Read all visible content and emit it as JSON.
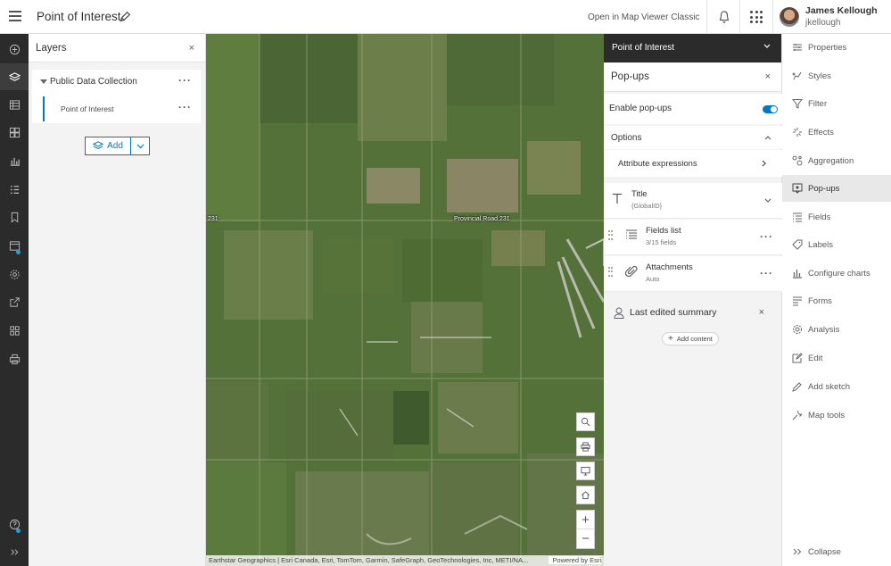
{
  "header": {
    "app_title": "Point of Interest",
    "open_classic": "Open in Map Viewer Classic",
    "user_name": "James Kellough",
    "user_id": "jkellough"
  },
  "layers_panel": {
    "title": "Layers",
    "close": "×",
    "group_label": "Public Data Collection",
    "layer_label": "Point of Interest",
    "menu": "···",
    "add_label": "Add"
  },
  "map": {
    "road_label": "Provincial Road 231",
    "road_label_short": "231",
    "attribution": "Earthstar Geographics | Esri Canada, Esri, TomTom, Garmin, SafeGraph, GeoTechnologies, Inc, METI/NA...",
    "powered_by": "Powered by Esri",
    "zoom_in": "+",
    "zoom_out": "−"
  },
  "config_panel": {
    "layer_name": "Point of Interest",
    "section_title": "Pop-ups",
    "close": "×",
    "enable_label": "Enable pop-ups",
    "enabled": true,
    "options_label": "Options",
    "attr_expr_label": "Attribute expressions",
    "title_row": {
      "title": "Title",
      "sub": "{GlobalID}"
    },
    "fields_row": {
      "title": "Fields list",
      "sub": "3/15 fields"
    },
    "attach_row": {
      "title": "Attachments",
      "sub": "Auto"
    },
    "last_edited_label": "Last edited summary",
    "add_content_label": "Add content",
    "menu": "···"
  },
  "right_rail": {
    "items": [
      {
        "label": "Properties",
        "icon": "properties-icon"
      },
      {
        "label": "Styles",
        "icon": "styles-icon"
      },
      {
        "label": "Filter",
        "icon": "filter-icon"
      },
      {
        "label": "Effects",
        "icon": "effects-icon"
      },
      {
        "label": "Aggregation",
        "icon": "aggregation-icon"
      },
      {
        "label": "Pop-ups",
        "icon": "popups-icon"
      },
      {
        "label": "Fields",
        "icon": "fields-icon"
      },
      {
        "label": "Labels",
        "icon": "labels-icon"
      },
      {
        "label": "Configure charts",
        "icon": "charts-icon"
      },
      {
        "label": "Forms",
        "icon": "forms-icon"
      },
      {
        "label": "Analysis",
        "icon": "analysis-icon"
      },
      {
        "label": "Edit",
        "icon": "edit-icon"
      },
      {
        "label": "Add sketch",
        "icon": "sketch-icon"
      },
      {
        "label": "Map tools",
        "icon": "map-tools-icon"
      }
    ],
    "active_item": "Pop-ups",
    "collapse_label": "Collapse"
  },
  "colors": {
    "accent": "#0079c1",
    "dark_rail": "#2b2b2b"
  }
}
